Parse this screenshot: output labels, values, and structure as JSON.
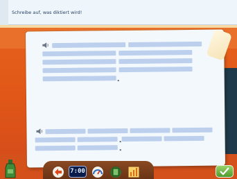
{
  "header": {
    "instruction": "Schreibe auf, was diktiert wird!"
  },
  "toolbar": {
    "clock_display": "7:00"
  },
  "icons": {
    "speaker_1": "speaker-icon",
    "speaker_2": "speaker-icon",
    "back": "back-arrow-icon",
    "clock": "clock-icon",
    "gauge": "gauge-icon",
    "notebook": "notebook-icon",
    "stats": "bar-chart-icon",
    "check": "checkmark-icon",
    "bottle": "potion-bottle-icon"
  },
  "colors": {
    "gap_fill": "#bcd0ee",
    "paper": "#f3f8fc",
    "accent_orange": "#e25a18",
    "check_green": "#4f9a2f"
  }
}
